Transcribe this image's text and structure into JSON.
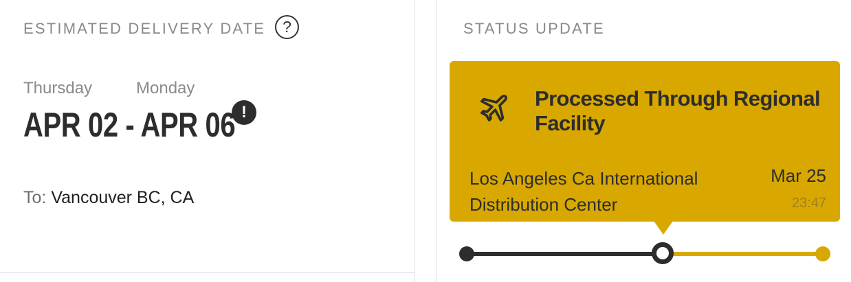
{
  "delivery": {
    "section_label": "ESTIMATED DELIVERY DATE",
    "help_glyph": "?",
    "start_day": "Thursday",
    "end_day": "Monday",
    "date_range": "APR 02 - APR 06",
    "alert_glyph": "!",
    "to_prefix": "To:",
    "destination": "Vancouver BC, CA"
  },
  "status": {
    "section_label": "STATUS UPDATE",
    "icon": "airplane-icon",
    "title": "Processed Through Regional Facility",
    "location": "Los Angeles Ca International Distribution Center",
    "date": "Mar 25",
    "time": "23:47",
    "colors": {
      "accent": "#d8a800",
      "dark": "#2d2d2d"
    }
  }
}
